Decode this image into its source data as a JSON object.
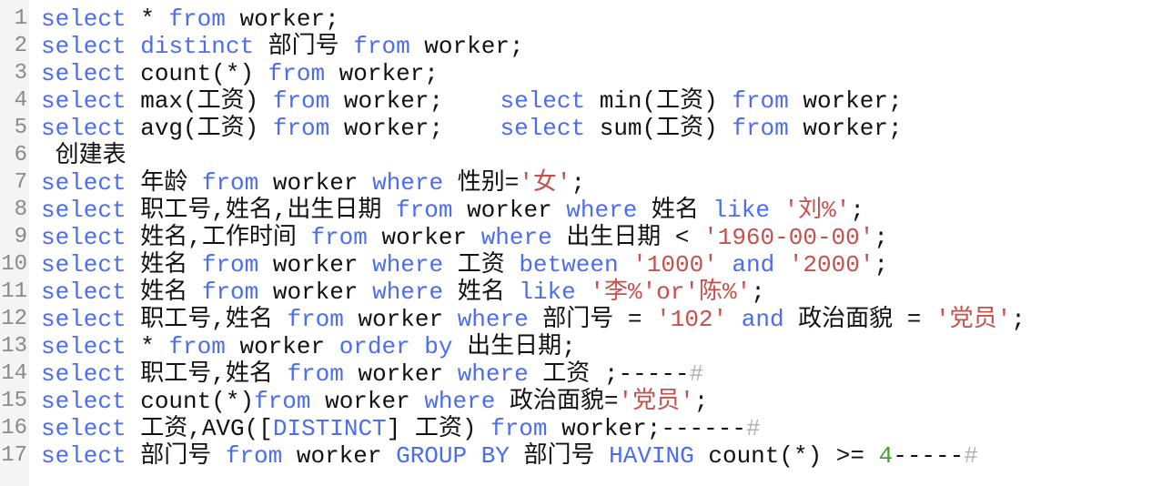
{
  "colors": {
    "keyword": "#4a6cf7",
    "string": "#c8504a",
    "number": "#3fa32a",
    "comment": "#b0b0b0",
    "text": "#111111",
    "line_number": "#8a8a8a"
  },
  "lines": [
    {
      "number": "1",
      "tokens": [
        [
          "kw",
          "select"
        ],
        [
          "tx",
          " * "
        ],
        [
          "kw",
          "from"
        ],
        [
          "tx",
          " worker;"
        ]
      ]
    },
    {
      "number": "2",
      "tokens": [
        [
          "kw",
          "select"
        ],
        [
          "tx",
          " "
        ],
        [
          "kw",
          "distinct"
        ],
        [
          "tx",
          " 部门号 "
        ],
        [
          "kw",
          "from"
        ],
        [
          "tx",
          " worker;"
        ]
      ]
    },
    {
      "number": "3",
      "tokens": [
        [
          "kw",
          "select"
        ],
        [
          "tx",
          " count(*) "
        ],
        [
          "kw",
          "from"
        ],
        [
          "tx",
          " worker;"
        ]
      ]
    },
    {
      "number": "4",
      "tokens": [
        [
          "kw",
          "select"
        ],
        [
          "tx",
          " max(工资) "
        ],
        [
          "kw",
          "from"
        ],
        [
          "tx",
          " worker;    "
        ],
        [
          "kw",
          "select"
        ],
        [
          "tx",
          " min(工资) "
        ],
        [
          "kw",
          "from"
        ],
        [
          "tx",
          " worker;"
        ]
      ]
    },
    {
      "number": "5",
      "tokens": [
        [
          "kw",
          "select"
        ],
        [
          "tx",
          " avg(工资) "
        ],
        [
          "kw",
          "from"
        ],
        [
          "tx",
          " worker;    "
        ],
        [
          "kw",
          "select"
        ],
        [
          "tx",
          " sum(工资) "
        ],
        [
          "kw",
          "from"
        ],
        [
          "tx",
          " worker;"
        ]
      ]
    },
    {
      "number": "6",
      "tokens": [
        [
          "tx",
          " 创建表"
        ]
      ]
    },
    {
      "number": "7",
      "tokens": [
        [
          "kw",
          "select"
        ],
        [
          "tx",
          " 年龄 "
        ],
        [
          "kw",
          "from"
        ],
        [
          "tx",
          " worker "
        ],
        [
          "kw",
          "where"
        ],
        [
          "tx",
          " 性别="
        ],
        [
          "str",
          "'女'"
        ],
        [
          "tx",
          ";"
        ]
      ]
    },
    {
      "number": "8",
      "tokens": [
        [
          "kw",
          "select"
        ],
        [
          "tx",
          " 职工号,姓名,出生日期 "
        ],
        [
          "kw",
          "from"
        ],
        [
          "tx",
          " worker "
        ],
        [
          "kw",
          "where"
        ],
        [
          "tx",
          " 姓名 "
        ],
        [
          "kw",
          "like"
        ],
        [
          "tx",
          " "
        ],
        [
          "str",
          "'刘%'"
        ],
        [
          "tx",
          ";"
        ]
      ]
    },
    {
      "number": "9",
      "tokens": [
        [
          "kw",
          "select"
        ],
        [
          "tx",
          " 姓名,工作时间 "
        ],
        [
          "kw",
          "from"
        ],
        [
          "tx",
          " worker "
        ],
        [
          "kw",
          "where"
        ],
        [
          "tx",
          " 出生日期 < "
        ],
        [
          "str",
          "'1960-00-00'"
        ],
        [
          "tx",
          ";"
        ]
      ]
    },
    {
      "number": "10",
      "tokens": [
        [
          "kw",
          "select"
        ],
        [
          "tx",
          " 姓名 "
        ],
        [
          "kw",
          "from"
        ],
        [
          "tx",
          " worker "
        ],
        [
          "kw",
          "where"
        ],
        [
          "tx",
          " 工资 "
        ],
        [
          "kw",
          "between"
        ],
        [
          "tx",
          " "
        ],
        [
          "str",
          "'1000'"
        ],
        [
          "tx",
          " "
        ],
        [
          "kw",
          "and"
        ],
        [
          "tx",
          " "
        ],
        [
          "str",
          "'2000'"
        ],
        [
          "tx",
          ";"
        ]
      ]
    },
    {
      "number": "11",
      "tokens": [
        [
          "kw",
          "select"
        ],
        [
          "tx",
          " 姓名 "
        ],
        [
          "kw",
          "from"
        ],
        [
          "tx",
          " worker "
        ],
        [
          "kw",
          "where"
        ],
        [
          "tx",
          " 姓名 "
        ],
        [
          "kw",
          "like"
        ],
        [
          "tx",
          " "
        ],
        [
          "str",
          "'李%'or'陈%'"
        ],
        [
          "tx",
          ";"
        ]
      ]
    },
    {
      "number": "12",
      "tokens": [
        [
          "kw",
          "select"
        ],
        [
          "tx",
          " 职工号,姓名 "
        ],
        [
          "kw",
          "from"
        ],
        [
          "tx",
          " worker "
        ],
        [
          "kw",
          "where"
        ],
        [
          "tx",
          " 部门号 = "
        ],
        [
          "str",
          "'102'"
        ],
        [
          "tx",
          " "
        ],
        [
          "kw",
          "and"
        ],
        [
          "tx",
          " 政治面貌 = "
        ],
        [
          "str",
          "'党员'"
        ],
        [
          "tx",
          ";"
        ]
      ]
    },
    {
      "number": "13",
      "tokens": [
        [
          "kw",
          "select"
        ],
        [
          "tx",
          " * "
        ],
        [
          "kw",
          "from"
        ],
        [
          "tx",
          " worker "
        ],
        [
          "kw",
          "order by"
        ],
        [
          "tx",
          " 出生日期;"
        ]
      ]
    },
    {
      "number": "14",
      "tokens": [
        [
          "kw",
          "select"
        ],
        [
          "tx",
          " 职工号,姓名 "
        ],
        [
          "kw",
          "from"
        ],
        [
          "tx",
          " worker "
        ],
        [
          "kw",
          "where"
        ],
        [
          "tx",
          " 工资 ;-----"
        ],
        [
          "cm",
          "#"
        ]
      ]
    },
    {
      "number": "15",
      "tokens": [
        [
          "kw",
          "select"
        ],
        [
          "tx",
          " count(*)"
        ],
        [
          "kw",
          "from"
        ],
        [
          "tx",
          " worker "
        ],
        [
          "kw",
          "where"
        ],
        [
          "tx",
          " 政治面貌="
        ],
        [
          "str",
          "'党员'"
        ],
        [
          "tx",
          ";"
        ]
      ]
    },
    {
      "number": "16",
      "tokens": [
        [
          "kw",
          "select"
        ],
        [
          "tx",
          " 工资,AVG(["
        ],
        [
          "kw",
          "DISTINCT"
        ],
        [
          "tx",
          "] 工资) "
        ],
        [
          "kw",
          "from"
        ],
        [
          "tx",
          " worker;------"
        ],
        [
          "cm",
          "#"
        ]
      ]
    },
    {
      "number": "17",
      "tokens": [
        [
          "kw",
          "select"
        ],
        [
          "tx",
          " 部门号 "
        ],
        [
          "kw",
          "from"
        ],
        [
          "tx",
          " worker "
        ],
        [
          "kw",
          "GROUP BY"
        ],
        [
          "tx",
          " 部门号 "
        ],
        [
          "kw",
          "HAVING"
        ],
        [
          "tx",
          " count(*) >= "
        ],
        [
          "num",
          "4"
        ],
        [
          "tx",
          "-----"
        ],
        [
          "cm",
          "#"
        ]
      ]
    }
  ]
}
